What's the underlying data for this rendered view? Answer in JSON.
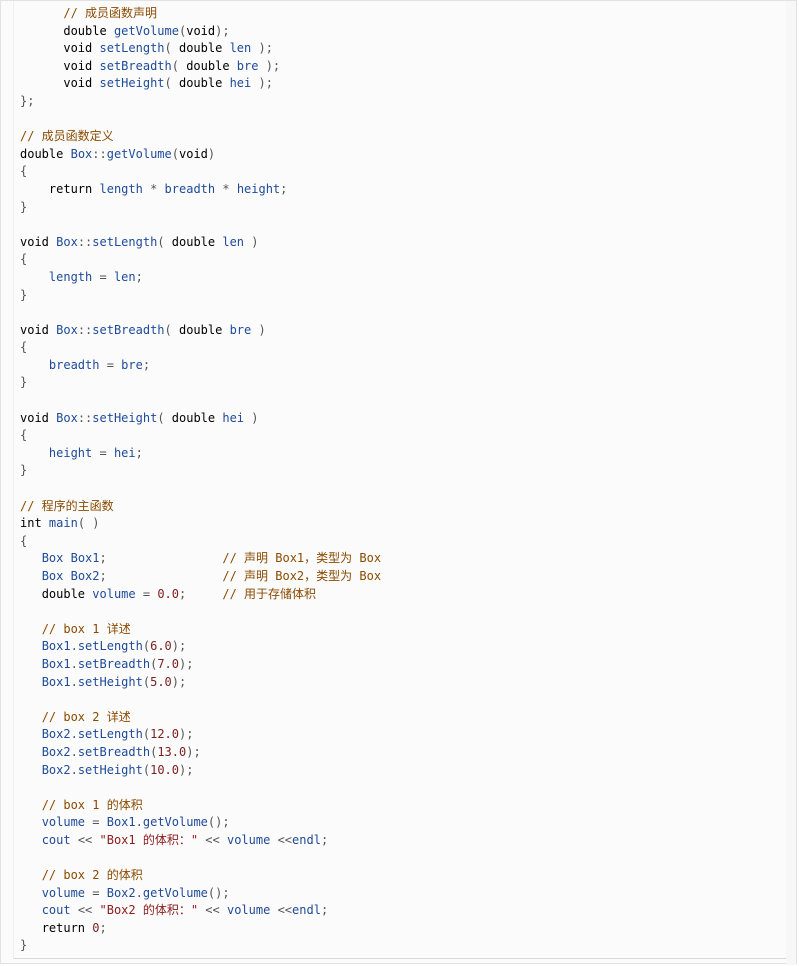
{
  "code_lines": [
    "      // 成员函数声明",
    "      double getVolume(void);",
    "      void setLength( double len );",
    "      void setBreadth( double bre );",
    "      void setHeight( double hei );",
    "};",
    "",
    "// 成员函数定义",
    "double Box::getVolume(void)",
    "{",
    "    return length * breadth * height;",
    "}",
    "",
    "void Box::setLength( double len )",
    "{",
    "    length = len;",
    "}",
    "",
    "void Box::setBreadth( double bre )",
    "{",
    "    breadth = bre;",
    "}",
    "",
    "void Box::setHeight( double hei )",
    "{",
    "    height = hei;",
    "}",
    "",
    "// 程序的主函数",
    "int main( )",
    "{",
    "   Box Box1;                // 声明 Box1，类型为 Box",
    "   Box Box2;                // 声明 Box2，类型为 Box",
    "   double volume = 0.0;     // 用于存储体积",
    "",
    "   // box 1 详述",
    "   Box1.setLength(6.0);",
    "   Box1.setBreadth(7.0);",
    "   Box1.setHeight(5.0);",
    "",
    "   // box 2 详述",
    "   Box2.setLength(12.0);",
    "   Box2.setBreadth(13.0);",
    "   Box2.setHeight(10.0);",
    "",
    "   // box 1 的体积",
    "   volume = Box1.getVolume();",
    "   cout << \"Box1 的体积：\" << volume <<endl;",
    "",
    "   // box 2 的体积",
    "   volume = Box2.getVolume();",
    "   cout << \"Box2 的体积：\" << volume <<endl;",
    "   return 0;",
    "}"
  ],
  "colors": {
    "keyword": "#000000",
    "identifier": "#1e4a99",
    "comment": "#8a4a00",
    "number": "#7a1f1f",
    "string": "#8b1a1a"
  }
}
